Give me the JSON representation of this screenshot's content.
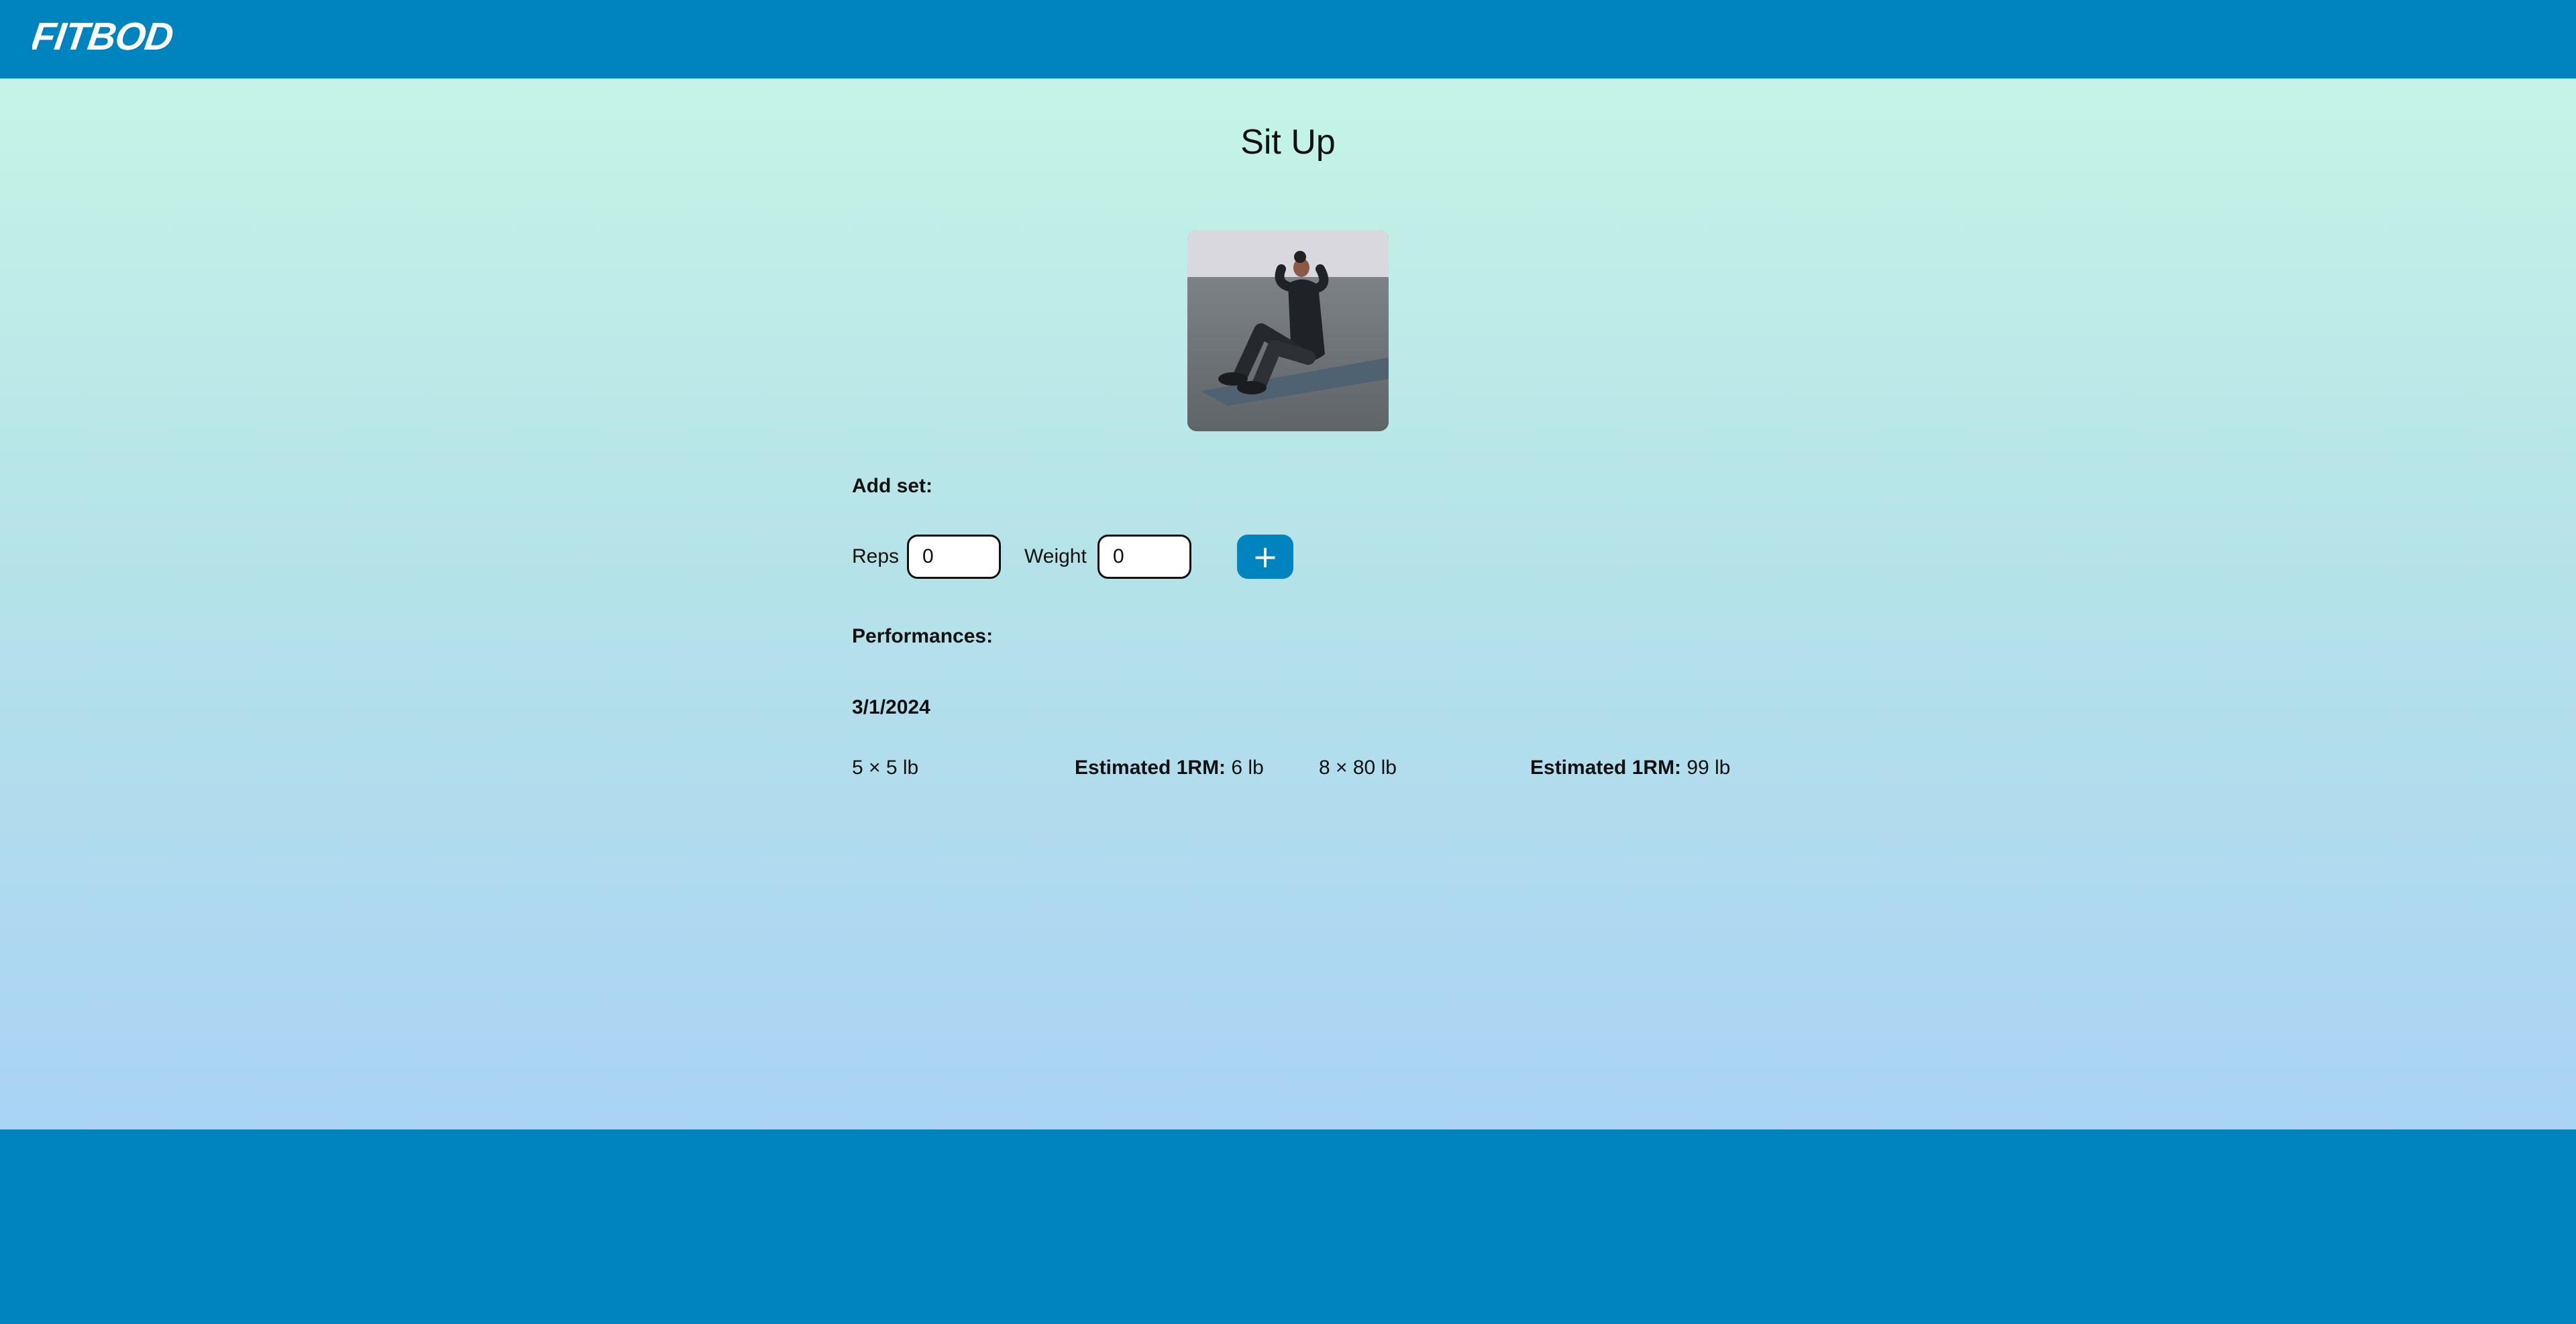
{
  "app": {
    "logo_text": "FITBOD"
  },
  "exercise": {
    "title": "Sit Up"
  },
  "add_set": {
    "heading": "Add set:",
    "reps_label": "Reps",
    "reps_value": "0",
    "weight_label": "Weight",
    "weight_value": "0",
    "add_button_label": "+"
  },
  "performances": {
    "heading": "Performances:",
    "groups": [
      {
        "date": "3/1/2024",
        "sets": [
          {
            "set": "5 × 5 lb",
            "estimate_label": "Estimated 1RM:",
            "estimate_value": "6 lb"
          },
          {
            "set": "8 × 80 lb",
            "estimate_label": "Estimated 1RM:",
            "estimate_value": "99 lb"
          }
        ]
      }
    ]
  },
  "colors": {
    "brand": "#0084c0",
    "gradient_top": "#c5f4e7",
    "gradient_bottom": "#aad3f5"
  }
}
